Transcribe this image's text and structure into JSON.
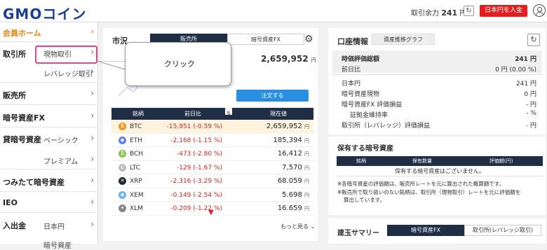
{
  "header": {
    "logo_gmo": "GMO",
    "logo_coin": "コイン",
    "funds_label": "取引余力",
    "funds_value": "241",
    "funds_unit": "円",
    "deposit_button": "日本円を入金"
  },
  "sidebar": {
    "home": "会員ホーム",
    "exchange": "取引所",
    "spot": "現物取引",
    "leverage": "レバレッジ取引",
    "sales": "販売所",
    "crypto_fx": "暗号資産FX",
    "lending": "貸暗号資産",
    "basic": "ベーシック",
    "premium": "プレミアム",
    "tsumitate": "つみたて暗号資産",
    "ieo": "IEO",
    "deposit": "入出金",
    "jpy": "日本円",
    "crypto": "暗号資産"
  },
  "market": {
    "title": "市況",
    "tab_sales": "販売所",
    "tab_fx": "暗号資産FX",
    "big_price": "2,659,952",
    "big_price_unit": "円",
    "order_button": "注文する",
    "col_symbol": "銘柄",
    "col_change": "前日比",
    "col_price": "現在値",
    "rows": [
      {
        "icon": "bitcoin-icon",
        "symbol": "BTC",
        "change": "-15,951 (-0.59 %)",
        "price": "2,659,952",
        "unit": "円",
        "color": "#f7931a",
        "glyph": "₿"
      },
      {
        "icon": "ethereum-icon",
        "symbol": "ETH",
        "change": "-2,168 (-1.15 %)",
        "price": "185,394",
        "unit": "円",
        "color": "#627eea",
        "glyph": "◆"
      },
      {
        "icon": "bitcoin-cash-icon",
        "symbol": "BCH",
        "change": "-473 (-2.80 %)",
        "price": "16,412",
        "unit": "円",
        "color": "#8dc351",
        "glyph": "₿"
      },
      {
        "icon": "litecoin-icon",
        "symbol": "LTC",
        "change": "-129 (-1.67 %)",
        "price": "7,570",
        "unit": "円",
        "color": "#bfbbbb",
        "glyph": "Ł"
      },
      {
        "icon": "xrp-icon",
        "symbol": "XRP",
        "change": "-2.316 (-3.29 %)",
        "price": "68.059",
        "unit": "円",
        "color": "#23292f",
        "glyph": "✕"
      },
      {
        "icon": "nem-icon",
        "symbol": "XEM",
        "change": "-0.149 (-2.54 %)",
        "price": "5.698",
        "unit": "円",
        "color": "#67b2e8",
        "glyph": "◉"
      },
      {
        "icon": "stellar-icon",
        "symbol": "XLM",
        "change": "-0.209 (-1.22 %)",
        "price": "16.659",
        "unit": "円",
        "color": "#888888",
        "glyph": "✦"
      }
    ],
    "more": "もっと見る"
  },
  "callout": {
    "text": "クリック"
  },
  "account": {
    "title": "口座情報",
    "graph_button": "資産推移グラフ",
    "total_label": "時価評価総額",
    "total_value": "241 円",
    "dod_label": "前日比",
    "dod_value": "0 円 (0.00 %)",
    "jpy_label": "日本円",
    "jpy_value": "241 円",
    "spot_label": "暗号資産現物",
    "spot_value": "0 円",
    "fx_label": "暗号資産FX 評価損益",
    "fx_value": "- 円",
    "margin_label": "証拠金維持率",
    "margin_value": "- %",
    "lev_label": "取引所（レバレッジ）評価損益",
    "lev_value": "- 円"
  },
  "holdings": {
    "title": "保有する暗号資産",
    "col_symbol": "銘柄",
    "col_qty": "保有数量",
    "col_value": "評価額(円)",
    "empty": "保有する暗号資産はございません。",
    "note1": "※各暗号資産の評価額は、販売所レートを元に算出された概算額です。",
    "note2": "※販売所で取り扱いのない銘柄は、取引所（現物取引）レートを元に評価額を",
    "note3": "算出しています。"
  },
  "positions": {
    "title": "建玉サマリー",
    "tab_fx": "暗号資産FX",
    "tab_lev": "取引所(レバレッジ取引)"
  }
}
